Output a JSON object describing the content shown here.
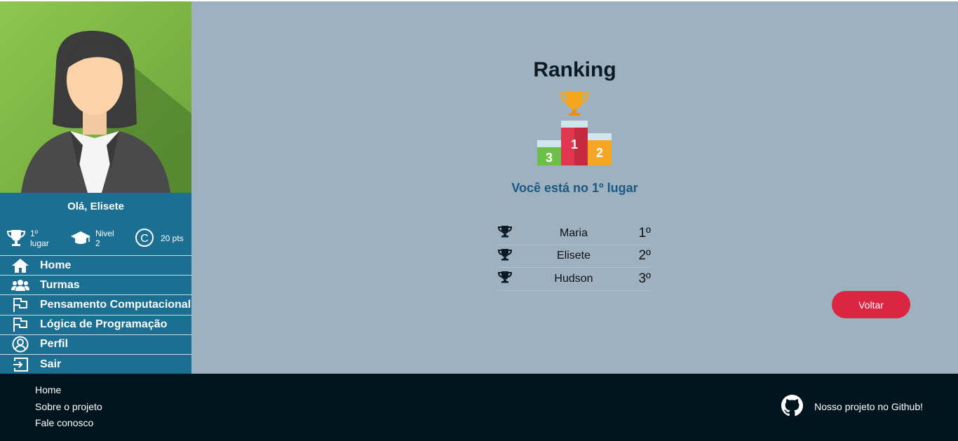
{
  "sidebar": {
    "greeting": "Olá, Elisete",
    "stats": {
      "rank_line1": "1º",
      "rank_line2": "lugar",
      "level_line1": "Nivel",
      "level_line2": "2",
      "points": "20 pts"
    },
    "menu": [
      {
        "label": "Home",
        "icon": "home-icon"
      },
      {
        "label": "Turmas",
        "icon": "users-icon"
      },
      {
        "label": "Pensamento Computacional",
        "icon": "flag-icon"
      },
      {
        "label": "Lógica de Programação",
        "icon": "flag-icon"
      },
      {
        "label": "Perfil",
        "icon": "user-circle-icon"
      },
      {
        "label": "Sair",
        "icon": "logout-icon"
      }
    ]
  },
  "main": {
    "title": "Ranking",
    "subtitle": "Você está no 1º lugar",
    "podium": {
      "first": "1",
      "second": "2",
      "third": "3"
    },
    "ranking": [
      {
        "name": "Maria",
        "position": "1º"
      },
      {
        "name": "Elisete",
        "position": "2º"
      },
      {
        "name": "Hudson",
        "position": "3º"
      }
    ],
    "back_label": "Voltar"
  },
  "footer": {
    "links": [
      "Home",
      "Sobre o projeto",
      "Fale conosco"
    ],
    "github_label": "Nosso projeto no Github!"
  },
  "colors": {
    "sidebar": "#1b6f92",
    "main_bg": "#9db1c0",
    "accent": "#dc2543",
    "footer": "#01151f"
  }
}
